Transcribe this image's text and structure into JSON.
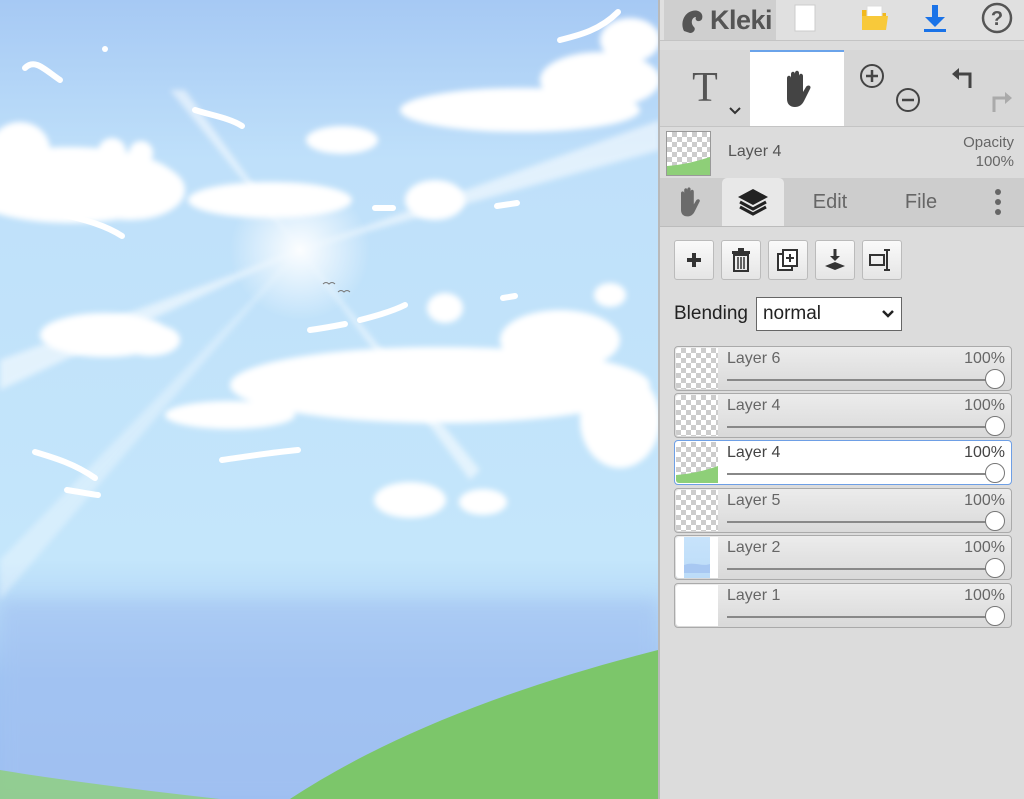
{
  "app": {
    "name": "Kleki"
  },
  "colors": {
    "accent": "#1a73e8",
    "panel_bg": "#dcdcdc",
    "folder": "#f2b91e",
    "sky_top": "#a9cdf5",
    "grass": "#7dc769"
  },
  "toolbar": {
    "icons": [
      "new-image-icon",
      "open-folder-icon",
      "download-icon",
      "help-icon"
    ],
    "help_label": "?"
  },
  "tools": {
    "text_label": "T",
    "icons": [
      "text-tool-icon",
      "hand-tool-icon",
      "zoom-in-icon",
      "zoom-out-icon",
      "undo-icon",
      "redo-icon"
    ]
  },
  "current_layer": {
    "name": "Layer 4",
    "opacity_label": "Opacity",
    "opacity_value": "100%"
  },
  "tabs": [
    {
      "id": "hand",
      "label": "",
      "icon": "hand-icon",
      "active": false
    },
    {
      "id": "layers",
      "label": "",
      "icon": "layers-icon",
      "active": true
    },
    {
      "id": "edit",
      "label": "Edit",
      "active": false
    },
    {
      "id": "file",
      "label": "File",
      "active": false
    },
    {
      "id": "more",
      "label": "",
      "icon": "more-vertical-icon",
      "active": false
    }
  ],
  "layer_buttons": [
    "add-layer-icon",
    "delete-layer-icon",
    "duplicate-layer-icon",
    "merge-down-icon",
    "rename-layer-icon"
  ],
  "blending": {
    "label": "Blending",
    "value": "normal"
  },
  "layers": [
    {
      "name": "Layer 6",
      "opacity": "100%",
      "opacity_fraction": 1.0,
      "thumb": "transparent",
      "selected": false
    },
    {
      "name": "Layer 4",
      "opacity": "100%",
      "opacity_fraction": 1.0,
      "thumb": "transparent",
      "selected": false
    },
    {
      "name": "Layer 4",
      "opacity": "100%",
      "opacity_fraction": 1.0,
      "thumb": "grass",
      "selected": true
    },
    {
      "name": "Layer 5",
      "opacity": "100%",
      "opacity_fraction": 1.0,
      "thumb": "transparent",
      "selected": false
    },
    {
      "name": "Layer 2",
      "opacity": "100%",
      "opacity_fraction": 1.0,
      "thumb": "sky",
      "selected": false
    },
    {
      "name": "Layer 1",
      "opacity": "100%",
      "opacity_fraction": 1.0,
      "thumb": "white",
      "selected": false
    }
  ]
}
